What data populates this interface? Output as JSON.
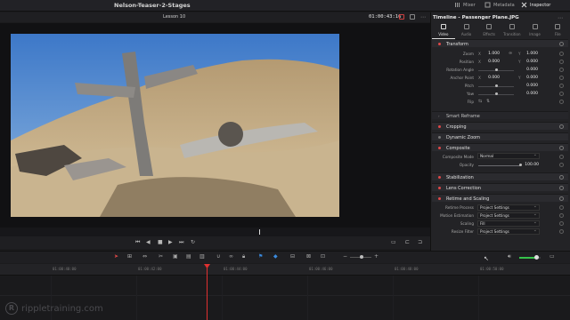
{
  "project": {
    "title": "Nelson-Teaser-2-Stages"
  },
  "top_tabs": [
    {
      "label": "Mixer",
      "icon": "mixer-icon"
    },
    {
      "label": "Metadata",
      "icon": "metadata-icon"
    },
    {
      "label": "Inspector",
      "icon": "inspector-icon"
    }
  ],
  "viewer": {
    "name": "Lesson 10",
    "timecode": "01:00:43:16"
  },
  "inspector": {
    "title": "Timeline - Passenger Plane.JPG",
    "tabs": [
      "Video",
      "Audio",
      "Effects",
      "Transition",
      "Image",
      "File"
    ],
    "transform": {
      "label": "Transform",
      "zoom": {
        "label": "Zoom",
        "x": "1.000",
        "y": "1.000"
      },
      "position": {
        "label": "Position",
        "x": "0.000",
        "y": "0.000"
      },
      "rotation": {
        "label": "Rotation Angle",
        "value": "0.000"
      },
      "anchor": {
        "label": "Anchor Point",
        "x": "0.000",
        "y": "0.000"
      },
      "pitch": {
        "label": "Pitch",
        "value": "0.000"
      },
      "yaw": {
        "label": "Yaw",
        "value": "0.000"
      },
      "flip": {
        "label": "Flip"
      },
      "axis_x": "X",
      "axis_y": "Y"
    },
    "sections": {
      "smart_reframe": "Smart Reframe",
      "cropping": "Cropping",
      "dynamic_zoom": "Dynamic Zoom",
      "composite": "Composite",
      "stabilization": "Stabilization",
      "lens_correction": "Lens Correction",
      "retime": "Retime and Scaling"
    },
    "composite": {
      "mode_label": "Composite Mode",
      "mode_value": "Normal",
      "opacity_label": "Opacity",
      "opacity_value": "100.00"
    },
    "retime": {
      "process_label": "Retime Process",
      "process_value": "Project Settings",
      "motion_label": "Motion Estimation",
      "motion_value": "Project Settings",
      "scaling_label": "Scaling",
      "scaling_value": "Fill",
      "resize_label": "Resize Filter",
      "resize_value": "Project Settings"
    }
  },
  "timeline": {
    "ruler": [
      "01:00:40:00",
      "01:00:42:00",
      "01:00:44:00",
      "01:00:46:00",
      "01:00:48:00",
      "01:00:50:00"
    ]
  },
  "watermark": {
    "text": "rippletraining.com",
    "logo": "R"
  },
  "colors": {
    "accent_red": "#e04848",
    "playhead": "#e03030",
    "volume": "#36c24a"
  }
}
